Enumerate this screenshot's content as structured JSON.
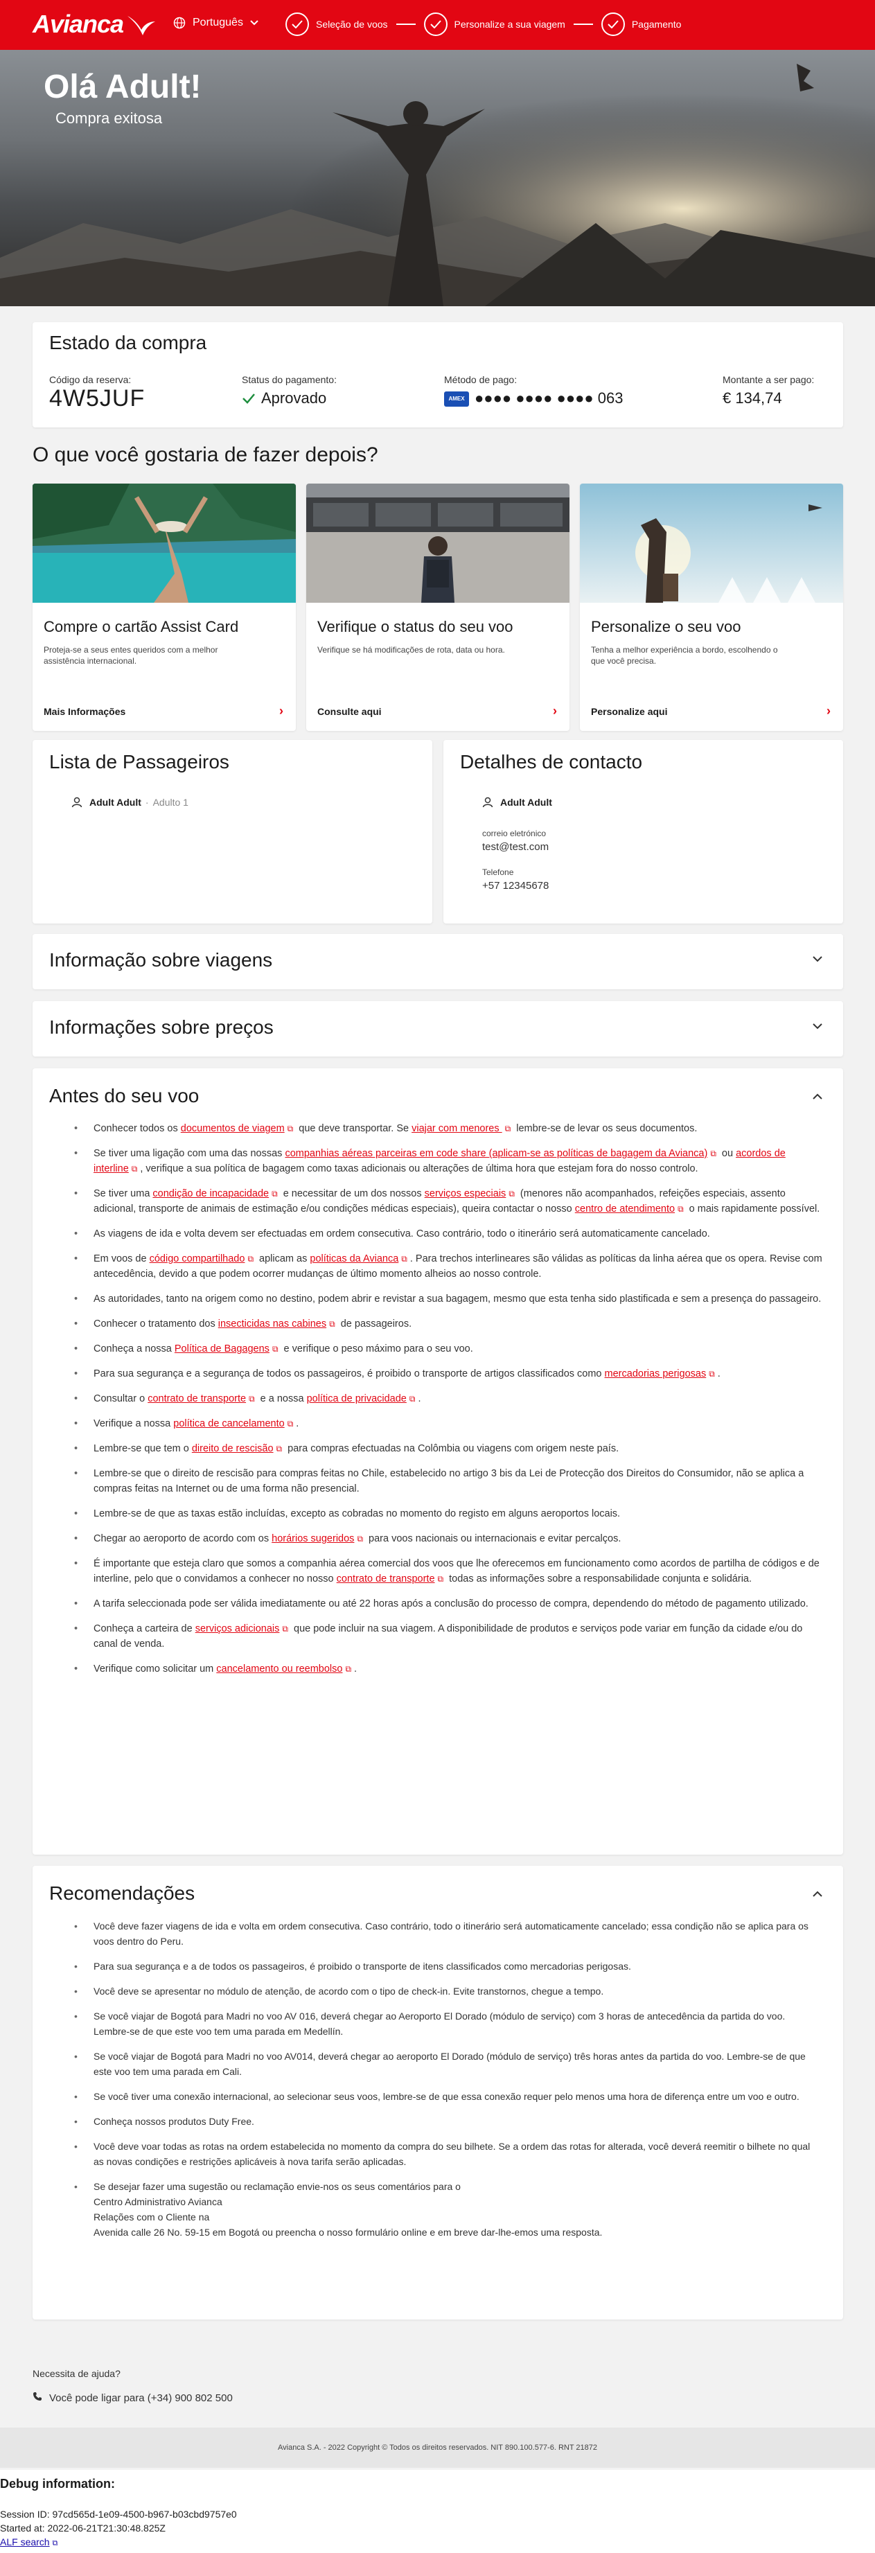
{
  "header": {
    "logo": "Avianca",
    "language": "Português",
    "steps": [
      {
        "label": "Seleção de voos"
      },
      {
        "label": "Personalize a sua viagem"
      },
      {
        "label": "Pagamento"
      }
    ],
    "brand_color": "#e20613"
  },
  "hero": {
    "title": "Olá Adult!",
    "subtitle": "Compra exitosa"
  },
  "estado": {
    "title": "Estado da compra",
    "code_label": "Código da reserva:",
    "code": "4W5JUF",
    "status_label": "Status do pagamento:",
    "status": "Aprovado",
    "method_label": "Método de pago:",
    "card_brand": "AMEX",
    "card_number": "●●●● ●●●● ●●●● 063",
    "amount_label": "Montante a ser pago:",
    "amount": "€ 134,74"
  },
  "next": {
    "title": "O que você gostaria de fazer depois?",
    "offers": [
      {
        "title": "Compre o cartão Assist Card",
        "desc": "Proteja-se a seus entes queridos com a melhor assistência internacional.",
        "link": "Mais Informações"
      },
      {
        "title": "Verifique o status do seu voo",
        "desc": "Verifique se há modificações de rota, data ou hora.",
        "link": "Consulte aqui"
      },
      {
        "title": "Personalize o seu voo",
        "desc": "Tenha a melhor experiência a bordo, escolhendo o que você precisa.",
        "link": "Personalize aqui"
      }
    ]
  },
  "passengers": {
    "title": "Lista de Passageiros",
    "name": "Adult Adult",
    "type": "Adulto 1"
  },
  "contact": {
    "title": "Detalhes de contacto",
    "name": "Adult Adult",
    "email_label": "correio eletrónico",
    "email": "test@test.com",
    "phone_label": "Telefone",
    "phone": "+57 12345678"
  },
  "accordions": {
    "travel_info": "Informação sobre viagens",
    "price_info": "Informações sobre preços",
    "before": "Antes do seu voo",
    "reco": "Recomendações"
  },
  "before_items": [
    {
      "a": "Conhecer todos os ",
      "l1": "documentos de viagem",
      "b": " que deve transportar. Se ",
      "l2": "viajar com menores ",
      "c": " lembre-se de levar os seus documentos."
    },
    {
      "a": "Se tiver uma ligação com uma das nossas ",
      "l1": "companhias aéreas parceiras em code share (aplicam-se as políticas de bagagem da Avianca)",
      "b": " ou ",
      "l2": "acordos de interline",
      "c": ", verifique a sua política de bagagem como taxas adicionais ou alterações de última hora que estejam fora do nosso controlo."
    },
    {
      "a": "Se tiver uma ",
      "l1": "condição de incapacidade",
      "b": " e necessitar de um dos nossos ",
      "l2": "serviços especiais",
      "c": " (menores não acompanhados, refeições especiais, assento adicional, transporte de animais de estimação e/ou condições médicas especiais), queira contactar o nosso ",
      "l3": "centro de atendimento",
      "d": " o mais rapidamente possível."
    },
    {
      "a": "As viagens de ida e volta devem ser efectuadas em ordem consecutiva. Caso contrário, todo o itinerário será automaticamente cancelado."
    },
    {
      "a": "Em voos de ",
      "l1": "código compartilhado",
      "b": " aplicam as ",
      "l2": "políticas da Avianca",
      "c": ". Para trechos interlineares são válidas as políticas da linha aérea que os opera. Revise com antecedência, devido a que podem ocorrer mudanças de último momento alheios ao nosso controle."
    },
    {
      "a": "As autoridades, tanto na origem como no destino, podem abrir e revistar a sua bagagem, mesmo que esta tenha sido plastificada e sem a presença do passageiro."
    },
    {
      "a": "Conhecer o tratamento dos ",
      "l1": "insecticidas nas cabines",
      "b": " de passageiros."
    },
    {
      "a": "Conheça a nossa ",
      "l1": "Política de Bagagens",
      "b": " e verifique o peso máximo para o seu voo."
    },
    {
      "a": "Para sua segurança e a segurança de todos os passageiros, é proibido o transporte de artigos classificados como ",
      "l1": "mercadorias perigosas",
      "b": "."
    },
    {
      "a": "Consultar o ",
      "l1": "contrato de transporte",
      "b": " e a nossa ",
      "l2": "política de privacidade",
      "c": "."
    },
    {
      "a": "Verifique a nossa ",
      "l1": "política de cancelamento",
      "b": "."
    },
    {
      "a": "Lembre-se que tem o ",
      "l1": "direito de rescisão",
      "b": " para compras efectuadas na Colômbia ou viagens com origem neste país."
    },
    {
      "a": "Lembre-se que o direito de rescisão para compras feitas no Chile, estabelecido no artigo 3 bis da Lei de Protecção dos Direitos do Consumidor, não se aplica a compras feitas na Internet ou de uma forma não presencial."
    },
    {
      "a": "Lembre-se de que as taxas estão incluídas, excepto as cobradas no momento do registo em alguns aeroportos locais."
    },
    {
      "a": "Chegar ao aeroporto de acordo com os ",
      "l1": "horários sugeridos",
      "b": " para voos nacionais ou internacionais e evitar percalços."
    },
    {
      "a": "É importante que esteja claro que somos a companhia aérea comercial dos voos que lhe oferecemos em funcionamento como acordos de partilha de códigos e de interline, pelo que o convidamos a conhecer no nosso ",
      "l1": "contrato de transporte",
      "b": " todas as informações sobre a responsabilidade conjunta e solidária."
    },
    {
      "a": "A tarifa seleccionada pode ser válida imediatamente ou até 22 horas após a conclusão do processo de compra, dependendo do método de pagamento utilizado."
    },
    {
      "a": "Conheça a carteira de ",
      "l1": "serviços adicionais",
      "b": " que pode incluir na sua viagem. A disponibilidade de produtos e serviços pode variar em função da cidade e/ou do canal de venda."
    },
    {
      "a": "Verifique como solicitar um ",
      "l1": "cancelamento ou reembolso",
      "b": "."
    }
  ],
  "reco_items": [
    "Você deve fazer viagens de ida e volta em ordem consecutiva. Caso contrário, todo o itinerário será automaticamente cancelado; essa condição não se aplica para os voos dentro do Peru.",
    "Para sua segurança e a de todos os passageiros, é proibido o transporte de itens classificados como mercadorias perigosas.",
    "Você deve se apresentar no módulo de atenção, de acordo com o tipo de check-in. Evite transtornos, chegue a tempo.",
    "Se você viajar de Bogotá para Madri no voo AV 016, deverá chegar ao Aeroporto El Dorado (módulo de serviço) com 3 horas de antecedência da partida do voo. Lembre-se de que este voo tem uma parada em Medellín.",
    "Se você viajar de Bogotá para Madri no voo AV014, deverá chegar ao aeroporto El Dorado (módulo de serviço) três horas antes da partida do voo. Lembre-se de que este voo tem uma parada em Cali.",
    "Se você tiver uma conexão internacional, ao selecionar seus voos, lembre-se de que essa conexão requer pelo menos uma hora de diferença entre um voo e outro.",
    "Conheça nossos produtos Duty Free.",
    "Você deve voar todas as rotas na ordem estabelecida no momento da compra do seu bilhete. Se a ordem das rotas for alterada, você deverá reemitir o bilhete no qual as novas condições e restrições aplicáveis à nova tarifa serão aplicadas.",
    "Se desejar fazer uma sugestão ou reclamação envie-nos os seus comentários para o"
  ],
  "reco_address": [
    "Centro Administrativo Avianca",
    "Relações com o Cliente na",
    "Avenida calle 26 No. 59-15 em Bogotá ou preencha o nosso formulário online e em breve dar-lhe-emos uma resposta."
  ],
  "help": {
    "question": "Necessita de ajuda?",
    "phone_text": "Você pode ligar para (+34) 900 802 500"
  },
  "footer": "Avianca S.A. - 2022 Copyright © Todos os direitos reservados. NIT 890.100.577-6. RNT 21872",
  "debug": {
    "title": "Debug information:",
    "session": "Session ID: 97cd565d-1e09-4500-b967-b03cbd9757e0",
    "started": "Started at: 2022-06-21T21:30:48.825Z",
    "alf": "ALF search"
  }
}
